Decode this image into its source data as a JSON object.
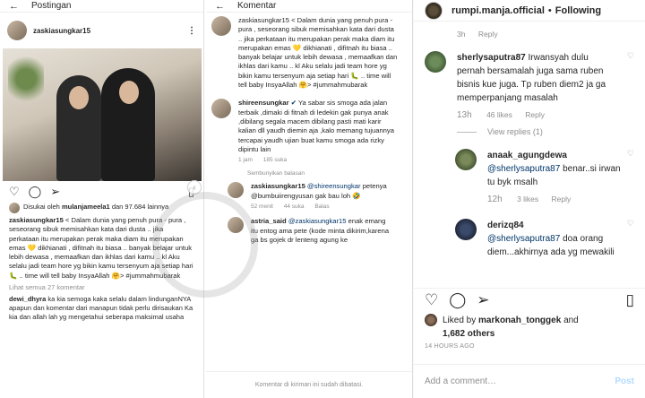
{
  "left_phone": {
    "header": "Postingan",
    "username": "zaskiasungkar15",
    "likes": {
      "prefix": "Disukai oleh",
      "user": "mulanjameela1",
      "suffix": "dan 97.684 lainnya"
    },
    "caption_user": "zaskiasungkar15",
    "caption": "< Dalam dunia yang penuh pura - pura , seseorang sibuk memisahkan kata dari dusta .. jika perkataan itu merupakan perak maka diam itu merupakan emas 💛 dikhianati , difitnah itu biasa .. banyak belajar untuk lebih dewasa , memaafkan dan ikhlas dari kamu .. kl Aku selalu jadi team hore yg bikin kamu tersenyum aja setiap hari 🐛 .. time will tell baby InsyaAllah 🤗> #jummahmubarak",
    "view_all": "Lihat semua 27 komentar",
    "comment_user": "dewi_dhyra",
    "comment_text": "ka kia semoga kaka selalu dalam lindunganNYA apapun dan komentar dari manapun tidak perlu dirisaukan Ka kia dan allah lah yg mengetahui seberapa maksimal usaha"
  },
  "mid_phone": {
    "header": "Komentar",
    "top": {
      "text": "zaskiasungkar15 < Dalam dunia yang penuh pura - pura , seseorang sibuk memisahkan kata dari dusta .. jika perkataan itu merupakan perak maka diam itu merupakan emas 💛 dikhianati , difitnah itu biasa .. banyak belajar untuk lebih dewasa , memaafkan dan ikhlas dari kamu .. kl Aku selalu jadi team hore yg bikin kamu tersenyum aja setiap hari 🐛 .. time will tell baby InsyaAllah 🤗> #jummahmubarak"
    },
    "c1": {
      "user": "shireensungkar",
      "text": "Ya sabar sis smoga ada jalan terbaik ,dimaki di fitnah di ledekin gak punya anak ,dibilang segala macem dibilang pasti mati karir kalian dll yaudh diemin aja ,kalo memang tujuannya tercapai yaudh ujian buat kamu smoga ada rizky dipintu lain",
      "time": "1 jam",
      "likes": "185 suka"
    },
    "hidden": "Sembunyikan balasan",
    "r1": {
      "user": "zaskiasungkar15",
      "mention": "@shireensungkar",
      "text": "petenya @bumbuiirengyusan gak bau loh 🤣",
      "time": "52 menit",
      "likes": "44 suka",
      "reply": "Balas"
    },
    "r2": {
      "user": "astria_said",
      "mention": "@zaskiasungkar15",
      "text": "enak emang itu entog ama pete (kode minta dikirim,karena ga bs gojek dr lenteng agung ke"
    },
    "footer": "Komentar di kiriman ini sudah dibatasi."
  },
  "right": {
    "account": "rumpi.manja.official",
    "follow": "Following",
    "top_meta_time": "3h",
    "top_meta_reply": "Reply",
    "comments": [
      {
        "user": "sherlysaputra87",
        "text": "Irwansyah dulu pernah bersamalah juga sama ruben bisnis kue juga. Tp ruben diem2 ja ga memperpanjang masalah",
        "time": "13h",
        "likes": "46 likes",
        "reply": "Reply",
        "view_replies": "View replies (1)"
      }
    ],
    "replies": [
      {
        "user": "anaak_agungdewa",
        "mention": "@sherlysaputra87",
        "text": "benar..si irwan tu byk msalh",
        "time": "12h",
        "likes": "3 likes",
        "reply": "Reply"
      },
      {
        "user": "derizq84",
        "mention": "@sherlysaputra87",
        "text": "doa orang diem...akhirnya ada yg mewakili"
      }
    ],
    "liked_by_prefix": "Liked by",
    "liked_by_user": "markonah_tonggek",
    "liked_by_and": "and",
    "liked_by_count": "1,682 others",
    "ago": "14 HOURS AGO",
    "add_comment": "Add a comment…",
    "post": "Post"
  }
}
